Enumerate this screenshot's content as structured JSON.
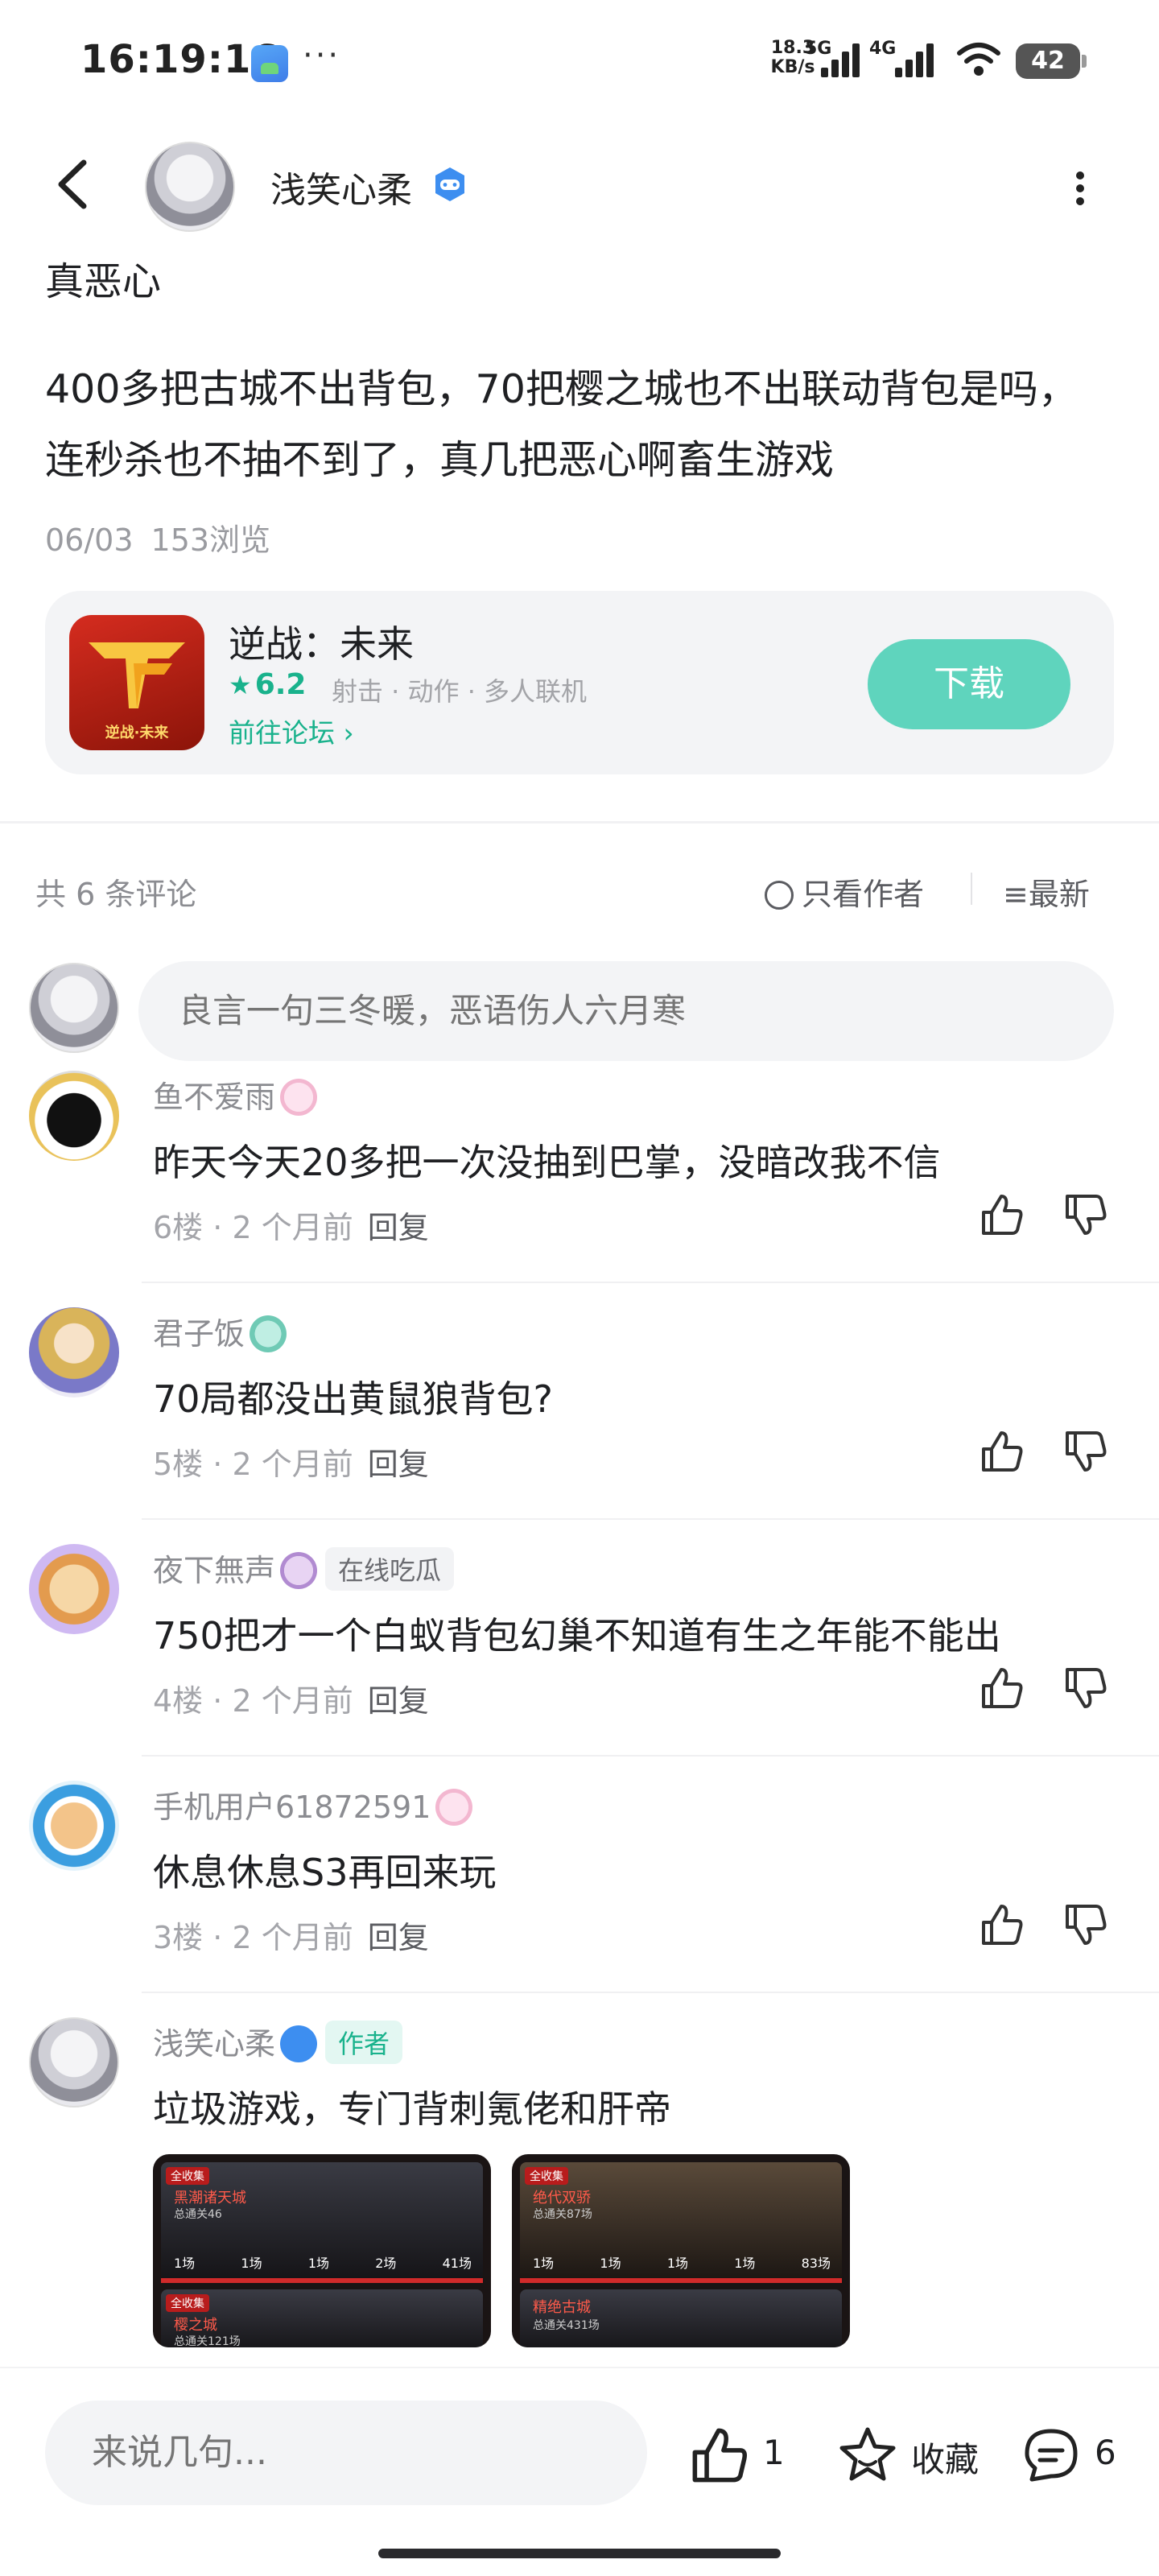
{
  "status_bar": {
    "time": "16:19:16",
    "dots": "···",
    "net_speed_value": "18.3",
    "net_speed_unit": "KB/s",
    "net_5g": "5G",
    "net_4g": "4G",
    "battery": "42"
  },
  "header": {
    "author_name": "浅笑心柔"
  },
  "post": {
    "title": "真恶心",
    "body": "400多把古城不出背包，70把樱之城也不出联动背包是吗，连秒杀也不抽不到了，真几把恶心啊畜生游戏",
    "date": "06/03",
    "views": "153浏览"
  },
  "game_card": {
    "name": "逆战：未来",
    "rating": "6.2",
    "tags": "射击 · 动作 · 多人联机",
    "forum_link": "前往论坛",
    "download_label": "下载",
    "accent_color": "#19b28c",
    "button_color": "#5fd4bd"
  },
  "comments_header": {
    "count_text": "共 6 条评论",
    "author_only": "只看作者",
    "sort": "最新"
  },
  "comment_input": {
    "placeholder": "良言一句三冬暖，恶语伤人六月寒"
  },
  "comments": [
    {
      "user": "鱼不爱雨",
      "text": "昨天今天20多把一次没抽到巴掌，没暗改我不信",
      "floor": "6楼",
      "time": "2 个月前",
      "reply": "回复",
      "avatar_icon": "black-cat-avatar"
    },
    {
      "user": "君子饭",
      "text": "70局都没出黄鼠狼背包?",
      "floor": "5楼",
      "time": "2 个月前",
      "reply": "回复",
      "avatar_icon": "character-avatar"
    },
    {
      "user": "夜下無声",
      "tag": "在线吃瓜",
      "text": "750把才一个白蚁背包幻巢不知道有生之年能不能出",
      "floor": "4楼",
      "time": "2 个月前",
      "reply": "回复",
      "avatar_icon": "cartoon-dog-avatar"
    },
    {
      "user": "手机用户61872591",
      "text": "休息休息S3再回来玩",
      "floor": "3楼",
      "time": "2 个月前",
      "reply": "回复",
      "avatar_icon": "shiba-avatar"
    },
    {
      "user": "浅笑心柔",
      "tag": "作者",
      "text": "垃圾游戏，专门背刺氪佬和肝帝",
      "avatar_icon": "author-avatar"
    }
  ],
  "screenshots": [
    {
      "chip": "全收集",
      "panel1_title": "黑潮诸天城",
      "panel1_sub": "总通关46",
      "panel1_stats": [
        "1场",
        "1场",
        "1场",
        "2场",
        "41场"
      ],
      "panel2_chip": "全收集",
      "panel2_title": "樱之城",
      "panel2_sub": "总通关121场"
    },
    {
      "chip": "全收集",
      "panel1_title": "绝代双骄",
      "panel1_sub": "总通关87场",
      "panel1_stats": [
        "1场",
        "1场",
        "1场",
        "1场",
        "83场"
      ],
      "panel2_title": "精绝古城",
      "panel2_sub": "总通关431场"
    }
  ],
  "bottom_bar": {
    "input_placeholder": "来说几句...",
    "like_count": "1",
    "favorite_label": "收藏",
    "comment_count": "6"
  }
}
